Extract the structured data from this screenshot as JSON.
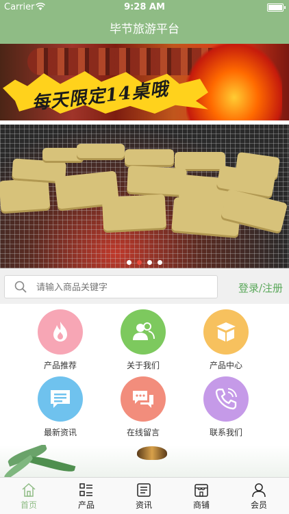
{
  "status_bar": {
    "carrier": "Carrier",
    "time": "9:28 AM"
  },
  "nav": {
    "title": "毕节旅游平台"
  },
  "banner_top": {
    "text": "每天限定14桌哦"
  },
  "search": {
    "placeholder": "请输入商品关键字",
    "login_label": "登录/注册"
  },
  "grid": [
    {
      "label": "产品推荐",
      "color": "#f7a6b5",
      "icon": "fire-icon"
    },
    {
      "label": "关于我们",
      "color": "#7dc95e",
      "icon": "users-icon"
    },
    {
      "label": "产品中心",
      "color": "#f7c15e",
      "icon": "box-icon"
    },
    {
      "label": "最新资讯",
      "color": "#6fc2ee",
      "icon": "message-icon"
    },
    {
      "label": "在线留言",
      "color": "#f28d7c",
      "icon": "chat-icon"
    },
    {
      "label": "联系我们",
      "color": "#c59ae8",
      "icon": "phone-icon"
    }
  ],
  "tabs": [
    {
      "label": "首页",
      "icon": "home-icon",
      "active": true
    },
    {
      "label": "产品",
      "icon": "list-icon"
    },
    {
      "label": "资讯",
      "icon": "news-icon"
    },
    {
      "label": "商铺",
      "icon": "store-icon"
    },
    {
      "label": "会员",
      "icon": "user-icon"
    }
  ],
  "colors": {
    "brand": "#8fbc85",
    "accent_text": "#5aa85a"
  }
}
